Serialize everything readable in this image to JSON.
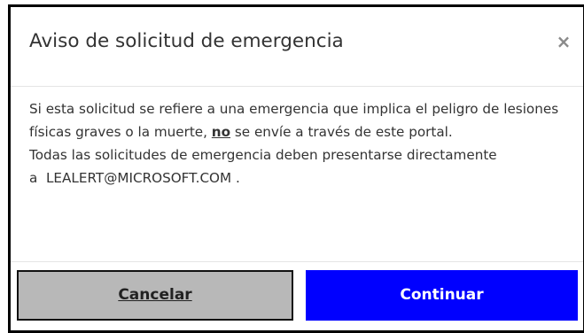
{
  "dialog": {
    "title": "Aviso de solicitud de emergencia",
    "close_icon": "×"
  },
  "body": {
    "line1_prefix": "Si esta solicitud se refiere a una emergencia que implica el peligro de lesiones físicas graves o la muerte, ",
    "line1_emphasis": "no",
    "line1_suffix": " se envíe a través de este portal.",
    "line2_prefix": "Todas las solicitudes de emergencia deben presentarse directamente",
    "line3_prefix": "a",
    "email": "LEALERT@MICROSOFT.COM",
    "line3_suffix": "."
  },
  "footer": {
    "cancel_label": "Cancelar",
    "continue_label": "Continuar"
  },
  "colors": {
    "continue_bg": "#0000ff",
    "cancel_bg": "#b8b8b8",
    "dialog_border": "#000000"
  }
}
